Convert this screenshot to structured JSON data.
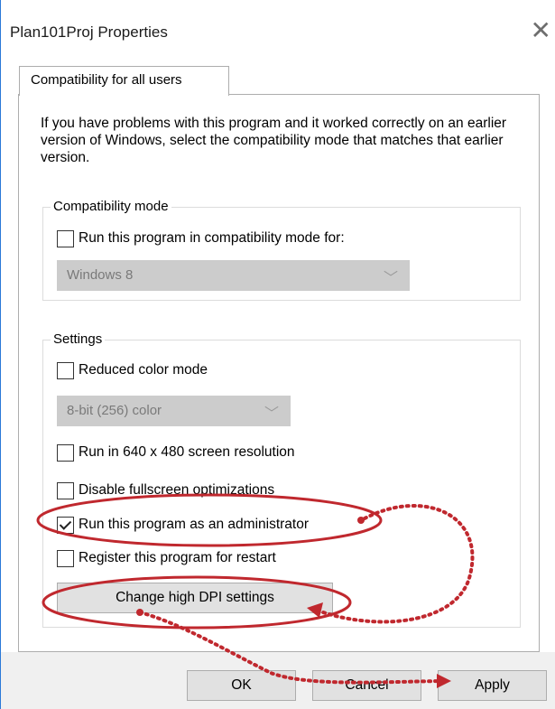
{
  "window": {
    "title": "Plan101Proj Properties",
    "close_glyph": "✕"
  },
  "tabs": [
    {
      "label": "Compatibility for all users",
      "selected": true
    }
  ],
  "intro_text": "If you have problems with this program and it worked correctly on an earlier version of Windows, select the compatibility mode that matches that earlier version.",
  "compatibility_mode": {
    "group_label": "Compatibility mode",
    "checkbox_label": "Run this program in compatibility mode for:",
    "checked": false,
    "dropdown_value": "Windows 8",
    "dropdown_enabled": false
  },
  "settings": {
    "group_label": "Settings",
    "reduced_color": {
      "label": "Reduced color mode",
      "checked": false
    },
    "color_dropdown_value": "8-bit (256) color",
    "resolution_640": {
      "label": "Run in 640 x 480 screen resolution",
      "checked": false
    },
    "disable_fullscreen": {
      "label": "Disable fullscreen optimizations",
      "checked": false
    },
    "run_as_admin": {
      "label": "Run this program as an administrator",
      "checked": true
    },
    "register_restart": {
      "label": "Register this program for restart",
      "checked": false
    },
    "dpi_button_label": "Change high DPI settings"
  },
  "footer": {
    "ok_label": "OK",
    "cancel_label": "Cancel",
    "apply_label": "Apply"
  },
  "colors": {
    "annotation_red": "#c0282e",
    "disabled_dropdown_bg": "#cccccc",
    "button_bg": "#e1e1e1",
    "footer_bg": "#f0f0f0"
  },
  "icons": {
    "close": "close-icon",
    "chevron": "chevron-down-icon",
    "checkmark": "checkmark-icon"
  }
}
